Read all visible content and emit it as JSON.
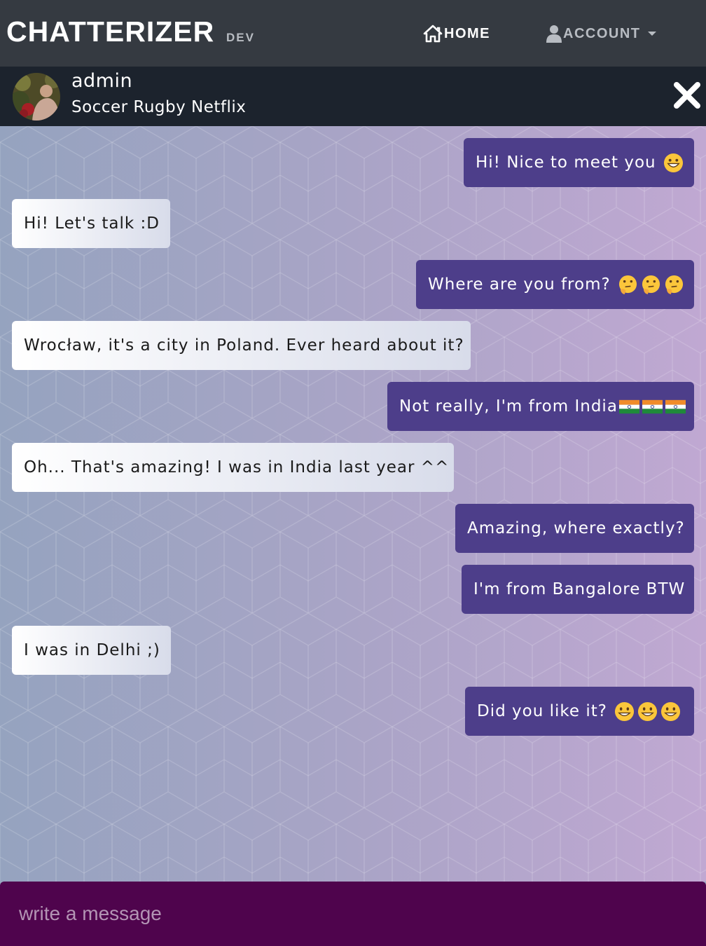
{
  "navbar": {
    "brand": "CHATTERIZER",
    "brand_tag": "DEV",
    "home_label": "HOME",
    "home_icon": "home-icon",
    "account_label": "ACCOUNT",
    "account_icon": "user-icon"
  },
  "chat_header": {
    "name": "admin",
    "interests": "Soccer Rugby Netflix",
    "close_icon": "close-icon"
  },
  "messages": [
    {
      "side": "out",
      "text": "Hi! Nice to meet you",
      "emoji": [
        "grinning-face"
      ]
    },
    {
      "side": "in",
      "text": "Hi! Let's talk :D"
    },
    {
      "side": "out",
      "text": "Where are you from?",
      "emoji": [
        "thinking-face",
        "thinking-face",
        "thinking-face"
      ]
    },
    {
      "side": "in",
      "text": "Wrocław, it's a city in Poland. Ever heard about it?"
    },
    {
      "side": "out",
      "text": "Not really, I'm from India",
      "emoji": [
        "india-flag",
        "india-flag",
        "india-flag"
      ]
    },
    {
      "side": "in",
      "text": "Oh... That's amazing! I was in India last year ^^"
    },
    {
      "side": "out",
      "text": "Amazing, where exactly?"
    },
    {
      "side": "out",
      "text": "I'm from Bangalore BTW"
    },
    {
      "side": "in",
      "text": "I was in Delhi ;)"
    },
    {
      "side": "out",
      "text": "Did you like it?",
      "emoji": [
        "smiling-face",
        "smiling-face",
        "smiling-face"
      ]
    }
  ],
  "composer": {
    "placeholder": "write a message"
  },
  "colors": {
    "navbar_bg": "#353a41",
    "chat_header_bg": "#1c232d",
    "outgoing_bubble": "#4d3e8a",
    "incoming_bubble": "#ffffff",
    "composer_bg": "#4f044d"
  }
}
